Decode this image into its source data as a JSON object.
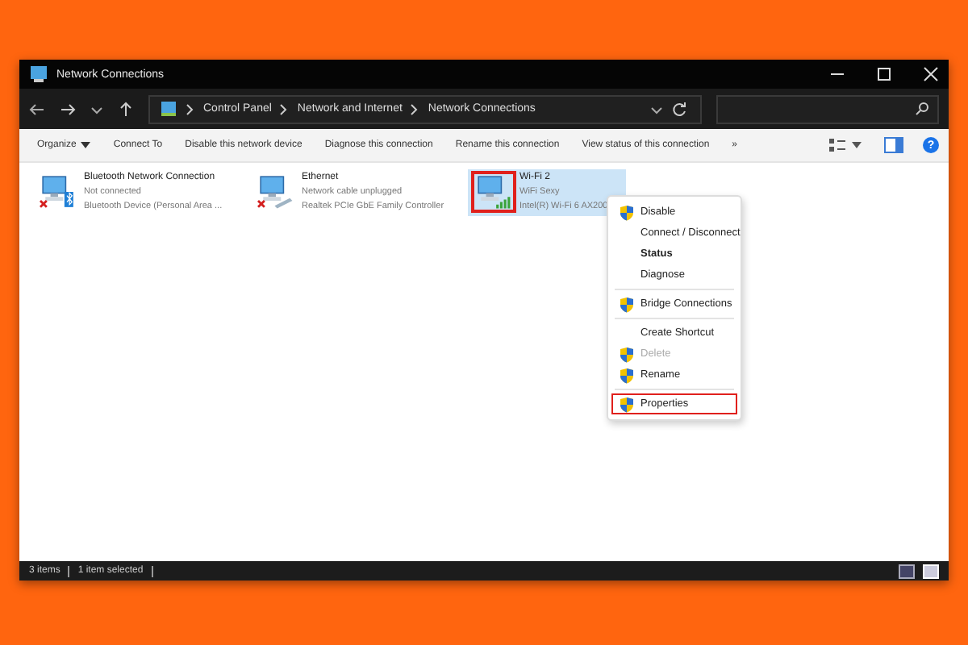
{
  "window": {
    "title": "Network Connections"
  },
  "address": {
    "crumbs": [
      "Control Panel",
      "Network and Internet",
      "Network Connections"
    ]
  },
  "toolbar": {
    "items": [
      {
        "label": "Organize",
        "dropdown": true
      },
      {
        "label": "Connect To",
        "dropdown": false
      },
      {
        "label": "Disable this network device",
        "dropdown": false
      },
      {
        "label": "Diagnose this connection",
        "dropdown": false
      },
      {
        "label": "Rename this connection",
        "dropdown": false
      },
      {
        "label": "View status of this connection",
        "dropdown": false
      },
      {
        "label": "»",
        "dropdown": false
      }
    ],
    "help": "?"
  },
  "connections": [
    {
      "kind": "bluetooth",
      "name": "Bluetooth Network Connection",
      "status": "Not connected",
      "device": "Bluetooth Device (Personal Area ...",
      "disconnected": true,
      "selected": false,
      "annotated": false
    },
    {
      "kind": "ethernet",
      "name": "Ethernet",
      "status": "Network cable unplugged",
      "device": "Realtek PCIe GbE Family Controller",
      "disconnected": true,
      "selected": false,
      "annotated": false
    },
    {
      "kind": "wifi",
      "name": "Wi-Fi 2",
      "status": "WiFi Sexy",
      "device": "Intel(R) Wi-Fi 6 AX200",
      "disconnected": false,
      "selected": true,
      "annotated": true
    }
  ],
  "context_menu": [
    {
      "kind": "command",
      "label": "Disable",
      "shield": true,
      "bold": false,
      "disabled": false,
      "annotated": false
    },
    {
      "kind": "command",
      "label": "Connect / Disconnect",
      "shield": false,
      "bold": false,
      "disabled": false,
      "annotated": false
    },
    {
      "kind": "command",
      "label": "Status",
      "shield": false,
      "bold": true,
      "disabled": false,
      "annotated": false
    },
    {
      "kind": "command",
      "label": "Diagnose",
      "shield": false,
      "bold": false,
      "disabled": false,
      "annotated": false
    },
    {
      "kind": "separator"
    },
    {
      "kind": "command",
      "label": "Bridge Connections",
      "shield": true,
      "bold": false,
      "disabled": false,
      "annotated": false
    },
    {
      "kind": "separator"
    },
    {
      "kind": "command",
      "label": "Create Shortcut",
      "shield": false,
      "bold": false,
      "disabled": false,
      "annotated": false
    },
    {
      "kind": "command",
      "label": "Delete",
      "shield": true,
      "bold": false,
      "disabled": true,
      "annotated": false
    },
    {
      "kind": "command",
      "label": "Rename",
      "shield": true,
      "bold": false,
      "disabled": false,
      "annotated": false
    },
    {
      "kind": "separator"
    },
    {
      "kind": "command",
      "label": "Properties",
      "shield": true,
      "bold": false,
      "disabled": false,
      "annotated": true
    }
  ],
  "status_bar": {
    "items": [
      "3 items",
      "1 item selected"
    ]
  }
}
